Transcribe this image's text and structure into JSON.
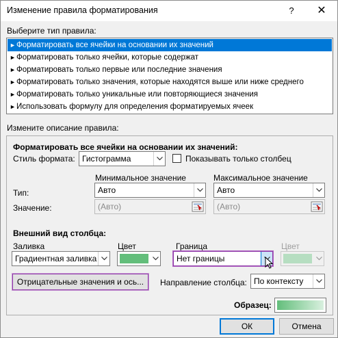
{
  "window": {
    "title": "Изменение правила форматирования",
    "help_label": "?",
    "close_label": "✕"
  },
  "rule_type": {
    "label": "Выберите тип правила:",
    "items": [
      "Форматировать все ячейки на основании их значений",
      "Форматировать только ячейки, которые содержат",
      "Форматировать только первые или последние значения",
      "Форматировать только значения, которые находятся выше или ниже среднего",
      "Форматировать только уникальные или повторяющиеся значения",
      "Использовать формулу для определения форматируемых ячеек"
    ],
    "selected_index": 0
  },
  "description": {
    "label": "Измените описание правила:",
    "heading": "Форматировать все ячейки на основании их значений:",
    "format_style_label": "Стиль формата:",
    "format_style_value": "Гистограмма",
    "bar_only_label": "Показывать только столбец",
    "bar_only_checked": false,
    "min_header": "Минимальное значение",
    "max_header": "Максимальное значение",
    "type_label": "Тип:",
    "value_label": "Значение:",
    "min_type": "Авто",
    "max_type": "Авто",
    "min_value": "(Авто)",
    "max_value": "(Авто)"
  },
  "bar_appearance": {
    "heading": "Внешний вид столбца:",
    "fill_label": "Заливка",
    "fill_value": "Градиентная заливка",
    "fill_color_label": "Цвет",
    "border_label": "Граница",
    "border_value": "Нет границы",
    "border_color_label": "Цвет",
    "negative_button": "Отрицательные значения и ось...",
    "direction_label": "Направление столбца:",
    "direction_value": "По контексту",
    "preview_label": "Образец:"
  },
  "buttons": {
    "ok": "ОК",
    "cancel": "Отмена"
  },
  "colors": {
    "selection": "#0078d7",
    "bar_green": "#63be7b"
  },
  "icons": {
    "value_picker": "range-picker-icon",
    "dropdown": "chevron-down-icon"
  }
}
